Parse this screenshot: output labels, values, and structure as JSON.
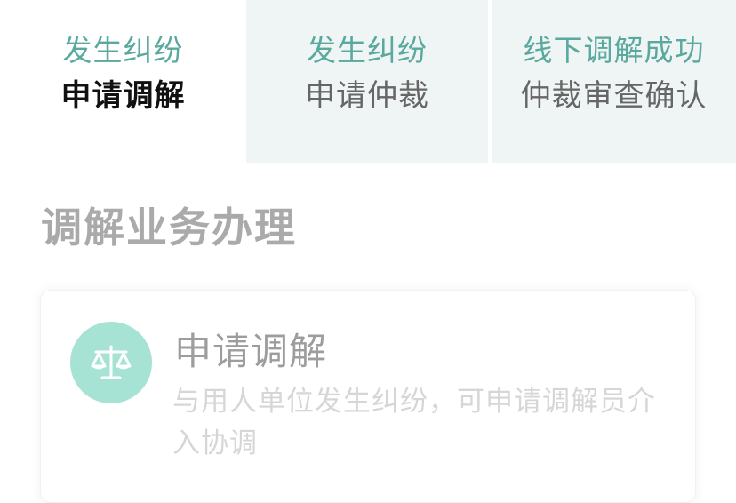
{
  "tabs": [
    {
      "line1": "发生纠纷",
      "line2": "申请调解",
      "active": true
    },
    {
      "line1": "发生纠纷",
      "line2": "申请仲裁",
      "active": false
    },
    {
      "line1": "线下调解成功",
      "line2": "仲裁审查确认",
      "active": false
    }
  ],
  "section": {
    "title": "调解业务办理"
  },
  "card": {
    "icon": "scale-icon",
    "title": "申请调解",
    "description": "与用人单位发生纠纷，可申请调解员介入协调"
  },
  "colors": {
    "accent": "#5aa89e",
    "tab_inactive_bg": "#eef5f4",
    "icon_bg": "#a7e3d4"
  }
}
